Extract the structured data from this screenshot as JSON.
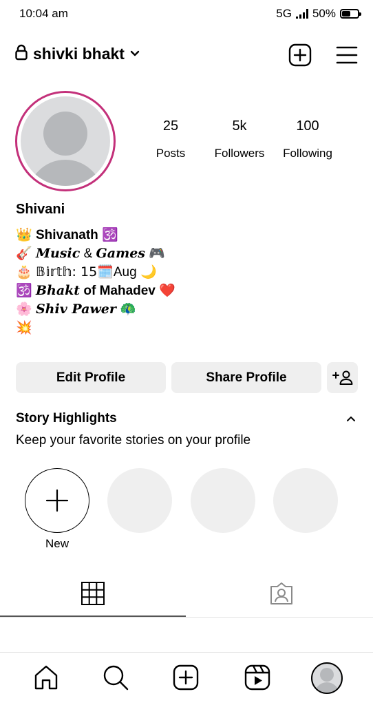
{
  "status_bar": {
    "time": "10:04 am",
    "network": "5G",
    "battery": "50%"
  },
  "header": {
    "username": "shivki bhakt"
  },
  "profile": {
    "stats": [
      {
        "value": "25",
        "label": "Posts"
      },
      {
        "value": "5k",
        "label": "Followers"
      },
      {
        "value": "100",
        "label": "Following"
      }
    ],
    "display_name": "Shivani",
    "bio": {
      "line1_emoji": "👑",
      "line1_text": "Shivanath",
      "line1_emoji2": "🕉️",
      "line2_emoji": "🎸",
      "line2_fancy1": "Music",
      "line2_mid": "&",
      "line2_fancy2": "Games",
      "line2_emoji2": "🎮",
      "line3_emoji": "🎂",
      "line3_text": "𝔹𝕚𝕣𝕥𝕙: 15",
      "line3_emoji2": "🗓️",
      "line3_text2": "Aug",
      "line3_emoji3": "🌙",
      "line4_emoji": "🕉️",
      "line4_fancy": "Bhakt",
      "line4_text": "of Mahadev",
      "line4_emoji2": "❤️",
      "line5_emoji": "🌸",
      "line5_fancy": "Shiv Pawer",
      "line5_emoji2": "🦚",
      "line6_emoji": "💥"
    }
  },
  "actions": {
    "edit_profile": "Edit Profile",
    "share_profile": "Share Profile"
  },
  "story_highlights": {
    "title": "Story Highlights",
    "subtitle": "Keep your favorite stories on your profile",
    "new_label": "New"
  },
  "colors": {
    "ring": "#c3307a",
    "button_bg": "#efefef",
    "placeholder": "#efefef"
  },
  "icons": {
    "header": [
      "lock-icon",
      "chevron-down-icon",
      "create-icon",
      "menu-icon"
    ],
    "tabs": [
      "grid-icon",
      "tagged-icon"
    ],
    "nav": [
      "home-icon",
      "search-icon",
      "create-icon",
      "reels-icon",
      "profile-avatar"
    ]
  }
}
